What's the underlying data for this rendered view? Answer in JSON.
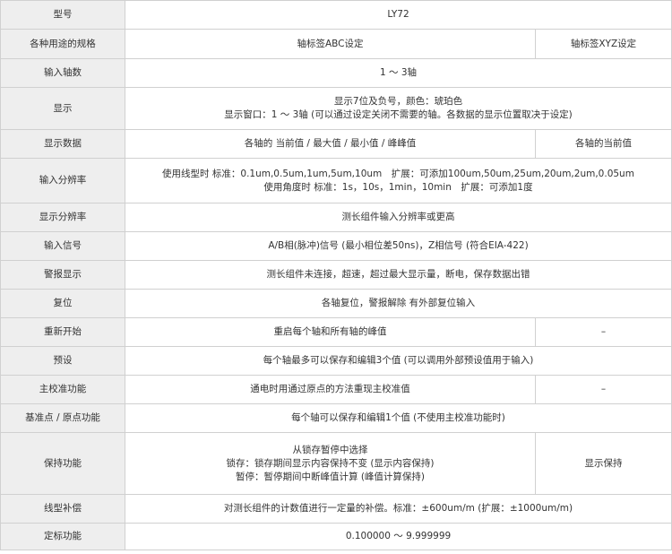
{
  "rows": [
    {
      "label": "型号",
      "cells": [
        [
          "LY72"
        ]
      ]
    },
    {
      "label": "各种用途的规格",
      "cells": [
        [
          "轴标签ABC设定"
        ],
        [
          "轴标签XYZ设定"
        ]
      ]
    },
    {
      "label": "输入轴数",
      "cells": [
        [
          "1 ～ 3轴"
        ]
      ]
    },
    {
      "label": "显示",
      "cells": [
        [
          "显示7位及负号，颜色：琥珀色",
          "显示窗口：1 ～ 3轴 (可以通过设定关闭不需要的轴。各数据的显示位置取决于设定)"
        ]
      ]
    },
    {
      "label": "显示数据",
      "cells": [
        [
          "各轴的 当前值 / 最大值 / 最小值 / 峰峰值"
        ],
        [
          "各轴的当前值"
        ]
      ]
    },
    {
      "label": "输入分辨率",
      "cells": [
        [
          "使用线型时 标准：0.1um,0.5um,1um,5um,10um　扩展：可添加100um,50um,25um,20um,2um,0.05um",
          "使用角度时 标准：1s，10s，1min，10min　扩展：可添加1度"
        ]
      ]
    },
    {
      "label": "显示分辨率",
      "cells": [
        [
          "测长组件输入分辨率或更高"
        ]
      ]
    },
    {
      "label": "输入信号",
      "cells": [
        [
          "A/B相(脉冲)信号 (最小相位差50ns)，Z相信号 (符合EIA-422)"
        ]
      ]
    },
    {
      "label": "警报显示",
      "cells": [
        [
          "测长组件未连接，超速，超过最大显示量，断电，保存数据出错"
        ]
      ]
    },
    {
      "label": "复位",
      "cells": [
        [
          "各轴复位，警报解除 有外部复位输入"
        ]
      ]
    },
    {
      "label": "重新开始",
      "cells": [
        [
          "重启每个轴和所有轴的峰值"
        ],
        [
          "–"
        ]
      ]
    },
    {
      "label": "预设",
      "cells": [
        [
          "每个轴最多可以保存和编辑3个值 (可以调用外部预设值用于输入)"
        ]
      ]
    },
    {
      "label": "主校准功能",
      "cells": [
        [
          "通电时用通过原点的方法重现主校准值"
        ],
        [
          "–"
        ]
      ]
    },
    {
      "label": "基准点 / 原点功能",
      "cells": [
        [
          "每个轴可以保存和编辑1个值 (不使用主校准功能时)"
        ]
      ]
    },
    {
      "label": "保持功能",
      "cells": [
        [
          "从锁存暂停中选择",
          "锁存：锁存期间显示内容保持不变 (显示内容保持)",
          "暂停：暂停期间中断峰值计算 (峰值计算保持)"
        ],
        [
          "显示保持"
        ]
      ]
    },
    {
      "label": "线型补偿",
      "cells": [
        [
          "对测长组件的计数值进行一定量的补偿。标准：±600um/m (扩展：±1000um/m)"
        ]
      ]
    },
    {
      "label": "定标功能",
      "cells": [
        [
          "0.100000 ～ 9.999999"
        ]
      ]
    }
  ]
}
